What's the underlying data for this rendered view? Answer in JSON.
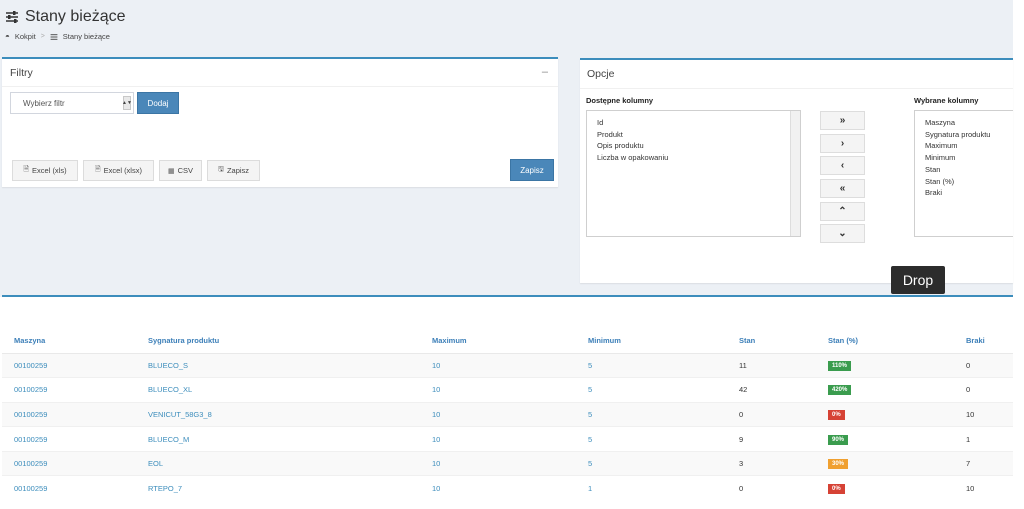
{
  "header": {
    "title": "Stany bieżące",
    "breadcrumb": {
      "home": "Kokpit",
      "current": "Stany bieżące"
    }
  },
  "filters": {
    "title": "Filtry",
    "collapse": "–",
    "select_value": "Wybierz filtr",
    "add_label": "Dodaj",
    "buttons": {
      "xls": "Excel (xls)",
      "xlsx": "Excel (xlsx)",
      "csv": "CSV",
      "zapisz": "Zapisz"
    },
    "save_label": "Zapisz"
  },
  "options": {
    "title": "Opcje",
    "available_label": "Dostępne kolumny",
    "selected_label": "Wybrane kolumny",
    "available": [
      "Id",
      "Produkt",
      "Opis produktu",
      "Liczba w opakowaniu"
    ],
    "selected": [
      "Maszyna",
      "Sygnatura produktu",
      "Maximum",
      "Minimum",
      "Stan",
      "Stan (%)",
      "Braki"
    ],
    "move_buttons": [
      "»",
      "›",
      "‹",
      "«",
      "⌃",
      "⌄"
    ]
  },
  "tooltip": "Drop",
  "table": {
    "headers": [
      "Maszyna",
      "Sygnatura produktu",
      "Maximum",
      "Minimum",
      "Stan",
      "Stan (%)",
      "Braki"
    ],
    "rows": [
      [
        "00100259",
        "BLUECO_S",
        "10",
        "5",
        "11",
        "110%",
        "0"
      ],
      [
        "00100259",
        "BLUECO_XL",
        "10",
        "5",
        "42",
        "420%",
        "0"
      ],
      [
        "00100259",
        "VENICUT_58G3_8",
        "10",
        "5",
        "0",
        "0%",
        "10"
      ],
      [
        "00100259",
        "BLUECO_M",
        "10",
        "5",
        "9",
        "90%",
        "1"
      ],
      [
        "00100259",
        "EOL",
        "10",
        "5",
        "3",
        "30%",
        "7"
      ],
      [
        "00100259",
        "RTEPO_7",
        "10",
        "1",
        "0",
        "0%",
        "10"
      ]
    ],
    "badge_colors": [
      "#3a9c4e",
      "#3a9c4e",
      "#d64235",
      "#3a9c4e",
      "#f0a030",
      "#d64235"
    ]
  }
}
